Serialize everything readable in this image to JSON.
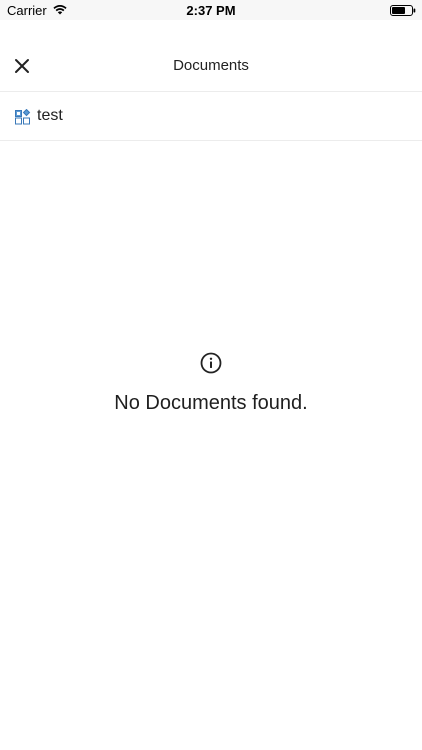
{
  "status_bar": {
    "carrier": "Carrier",
    "time": "2:37 PM",
    "icons": [
      "wifi-icon",
      "battery-icon"
    ]
  },
  "header": {
    "title": "Documents",
    "close_icon": "close-icon"
  },
  "folder": {
    "label": "test",
    "icon": "folder-grid-icon",
    "icon_color": "#4a90d9"
  },
  "empty_state": {
    "icon": "info-icon",
    "message": "No Documents found."
  }
}
